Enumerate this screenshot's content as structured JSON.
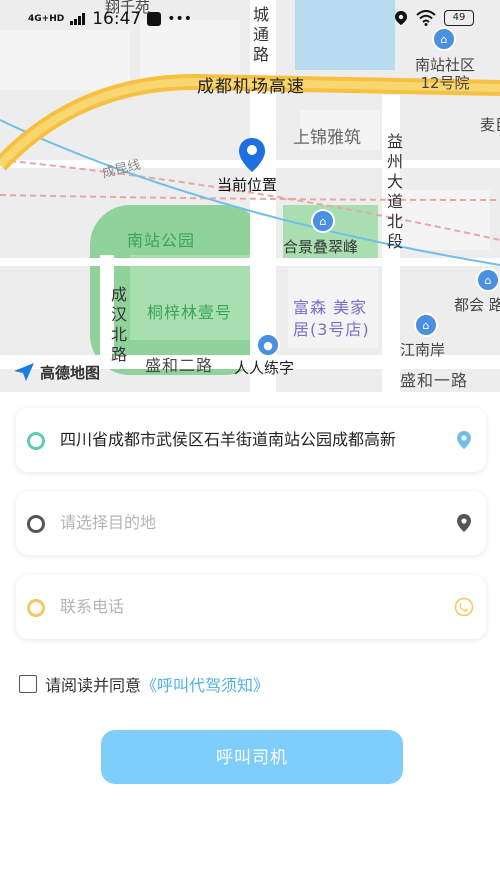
{
  "status_bar": {
    "time": "16:47",
    "network": "4G+HD",
    "battery": "49"
  },
  "map": {
    "brand": "高德地图",
    "current_location_label": "当前位置",
    "labels": {
      "expressway": "成都机场高速",
      "rail_line": "成昆线",
      "jinya": "上锦雅筑",
      "nanzhan_park": "南站公园",
      "hejing": "合景叠翠峰",
      "tongzilin": "桐梓林壹号",
      "fusen": "富森 美家\n居(3号店)",
      "shenghe2": "盛和二路",
      "renren": "人人练字",
      "shenghe1": "盛和一路",
      "jiangnan": "江南岸",
      "duhui": "都会 路",
      "mai": "麦巨",
      "nanzhan_community": "南站社区\n12号院",
      "road_top_left": "翔千苑",
      "vert_chengtong": "城通路",
      "vert_yizhou": "益州大道北段",
      "vert_chenghan": "成汉北路"
    }
  },
  "form": {
    "origin": {
      "value": "四川省成都市武侯区石羊街道南站公园成都高新",
      "color": "#5ccdb2"
    },
    "destination": {
      "placeholder": "请选择目的地",
      "color": "#555555"
    },
    "phone": {
      "placeholder": "联系电话",
      "color": "#f5c860"
    },
    "agreement": {
      "prefix": "请阅读并同意",
      "link": "《呼叫代驾须知》"
    },
    "submit_label": "呼叫司机"
  }
}
